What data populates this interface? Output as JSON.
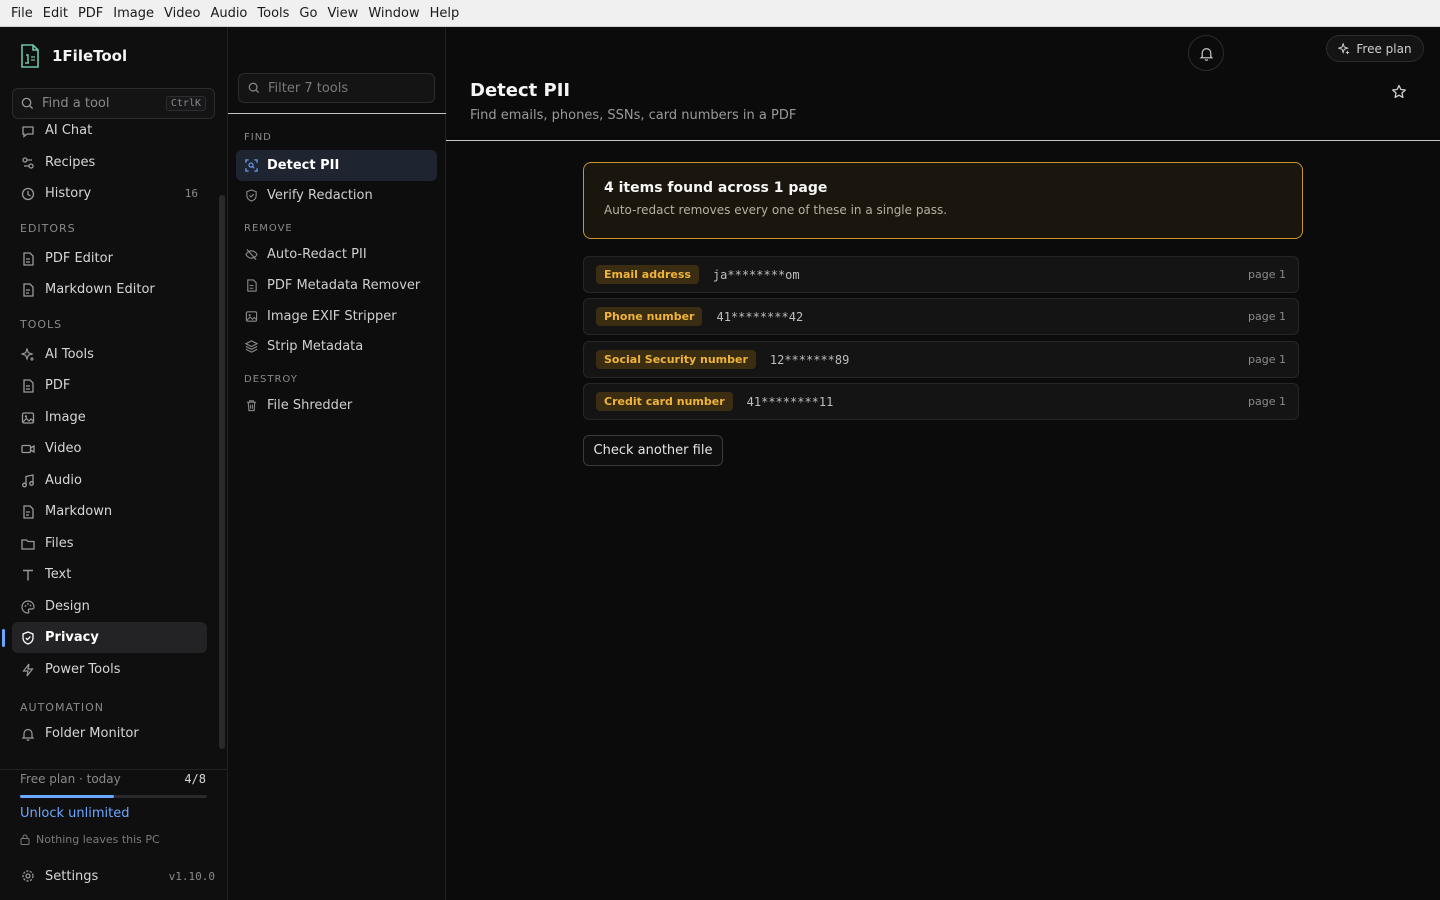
{
  "menubar": [
    "File",
    "Edit",
    "PDF",
    "Image",
    "Video",
    "Audio",
    "Tools",
    "Go",
    "View",
    "Window",
    "Help"
  ],
  "brand": {
    "name": "1FileTool"
  },
  "search": {
    "placeholder": "Find a tool",
    "shortcut": "CtrlK"
  },
  "sidebar": {
    "top_items": [
      {
        "label": "AI Chat",
        "icon": "chat-icon"
      },
      {
        "label": "Recipes",
        "icon": "recipes-icon"
      },
      {
        "label": "History",
        "icon": "history-icon",
        "count": "16"
      }
    ],
    "editors_label": "EDITORS",
    "editors": [
      {
        "label": "PDF Editor",
        "icon": "pdf-editor-icon"
      },
      {
        "label": "Markdown Editor",
        "icon": "markdown-editor-icon"
      }
    ],
    "tools_label": "TOOLS",
    "tools": [
      {
        "label": "AI Tools",
        "icon": "sparkle-icon"
      },
      {
        "label": "PDF",
        "icon": "pdf-icon"
      },
      {
        "label": "Image",
        "icon": "image-icon"
      },
      {
        "label": "Video",
        "icon": "video-icon"
      },
      {
        "label": "Audio",
        "icon": "audio-icon"
      },
      {
        "label": "Markdown",
        "icon": "markdown-icon"
      },
      {
        "label": "Files",
        "icon": "folder-icon"
      },
      {
        "label": "Text",
        "icon": "text-icon"
      },
      {
        "label": "Design",
        "icon": "palette-icon"
      },
      {
        "label": "Privacy",
        "icon": "shield-icon",
        "active": true
      },
      {
        "label": "Power Tools",
        "icon": "bolt-icon"
      }
    ],
    "automation_label": "AUTOMATION",
    "automation": [
      {
        "label": "Folder Monitor",
        "icon": "bell-icon"
      }
    ]
  },
  "plan": {
    "label": "Free plan · today",
    "count": "4/8",
    "usage_fraction": 0.5,
    "unlock": "Unlock unlimited",
    "local_note": "Nothing leaves this PC"
  },
  "settings": {
    "label": "Settings",
    "version": "v1.10.0"
  },
  "tools_panel": {
    "filter_placeholder": "Filter 7 tools",
    "find_label": "FIND",
    "remove_label": "REMOVE",
    "destroy_label": "DESTROY",
    "find": [
      {
        "label": "Detect PII",
        "active": true
      },
      {
        "label": "Verify Redaction"
      }
    ],
    "remove": [
      {
        "label": "Auto-Redact PII"
      },
      {
        "label": "PDF Metadata Remover"
      },
      {
        "label": "Image EXIF Stripper"
      },
      {
        "label": "Strip Metadata"
      }
    ],
    "destroy": [
      {
        "label": "File Shredder"
      }
    ]
  },
  "header": {
    "free_plan": "Free plan"
  },
  "main": {
    "title": "Detect PII",
    "subtitle": "Find emails, phones, SSNs, card numbers in a PDF",
    "summary_title": "4 items found across 1 page",
    "summary_text": "Auto-redact removes every one of these in a single pass.",
    "findings": [
      {
        "type": "Email address",
        "value": "ja********om",
        "page": "page 1"
      },
      {
        "type": "Phone number",
        "value": "41********42",
        "page": "page 1"
      },
      {
        "type": "Social Security number",
        "value": "12*******89",
        "page": "page 1"
      },
      {
        "type": "Credit card number",
        "value": "41********11",
        "page": "page 1"
      }
    ],
    "again_button": "Check another file"
  },
  "colors": {
    "accent": "#6aa7ff",
    "warning": "#f0b43c",
    "border_warning": "#c9962e"
  }
}
